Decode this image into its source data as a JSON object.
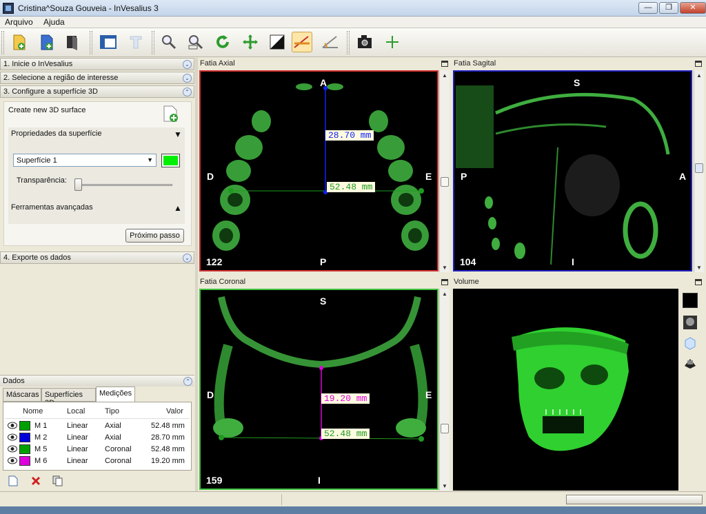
{
  "window": {
    "title": "Cristina^Souza Gouveia - InVesalius 3",
    "minimize": "—",
    "maximize": "❐",
    "close": "✕"
  },
  "menu": [
    "Arquivo",
    "Ajuda"
  ],
  "toolbar": {
    "icons": [
      "import-icon",
      "open-icon",
      "close-project-icon",
      "layout-icon",
      "text-icon",
      "zoom-icon",
      "zoom-select-icon",
      "rotate-icon",
      "pan-icon",
      "contrast-icon",
      "linear-measure-icon",
      "angular-measure-icon",
      "screenshot-icon",
      "add-icon"
    ],
    "active": "linear-measure-icon"
  },
  "left": {
    "sections": [
      "1. Inicie o InVesalius",
      "2. Selecione a região de interesse",
      "3. Configure a superfície 3D",
      "4. Exporte os dados"
    ],
    "create_new": "Create new 3D surface",
    "surface_props": "Propriedades da superfície",
    "surface_select": "Superfície 1",
    "surface_color": "#00ee00",
    "transparency": "Transparência:",
    "advanced_tools": "Ferramentas avançadas",
    "next_step": "Próximo passo"
  },
  "data_panel": {
    "title": "Dados",
    "tabs": [
      "Máscaras",
      "Superfícies 3D",
      "Medições"
    ],
    "selected_tab": "Medições",
    "columns": [
      "Nome",
      "Local",
      "Tipo",
      "Valor"
    ],
    "rows": [
      {
        "name": "M 1",
        "local": "Linear",
        "tipo": "Axial",
        "valor": "52.48 mm",
        "color": "#00a000"
      },
      {
        "name": "M 2",
        "local": "Linear",
        "tipo": "Axial",
        "valor": "28.70 mm",
        "color": "#0000dd"
      },
      {
        "name": "M 5",
        "local": "Linear",
        "tipo": "Coronal",
        "valor": "52.48 mm",
        "color": "#00a000"
      },
      {
        "name": "M 6",
        "local": "Linear",
        "tipo": "Coronal",
        "valor": "19.20 mm",
        "color": "#dd00dd"
      }
    ]
  },
  "viewports": {
    "axial": {
      "title": "Fatia Axial",
      "top": "A",
      "bottom": "P",
      "left": "D",
      "right": "E",
      "slice": "122",
      "m1": "28.70 mm",
      "m2": "52.48 mm",
      "border": "#d03030"
    },
    "sagittal": {
      "title": "Fatia Sagital",
      "top": "S",
      "bottom": "I",
      "left": "P",
      "right": "A",
      "slice": "104",
      "border": "#2020c0"
    },
    "coronal": {
      "title": "Fatia Coronal",
      "top": "S",
      "bottom": "I",
      "left": "D",
      "right": "E",
      "slice": "159",
      "m1": "19.20 mm",
      "m2": "52.48 mm",
      "border": "#40c040"
    },
    "volume": {
      "title": "Volume"
    }
  }
}
